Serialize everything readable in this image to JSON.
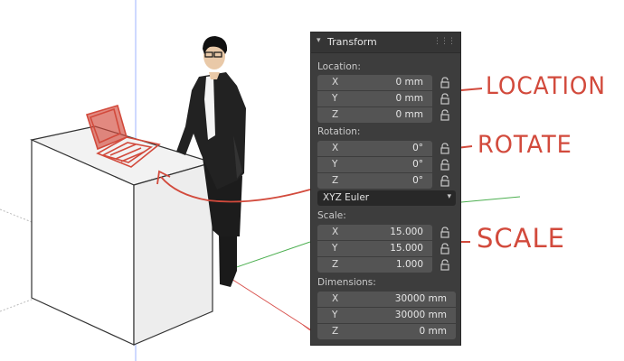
{
  "panel": {
    "title": "Transform",
    "location_label": "Location:",
    "location": [
      {
        "axis": "X",
        "value": "0 mm"
      },
      {
        "axis": "Y",
        "value": "0 mm"
      },
      {
        "axis": "Z",
        "value": "0 mm"
      }
    ],
    "rotation_label": "Rotation:",
    "rotation": [
      {
        "axis": "X",
        "value": "0°"
      },
      {
        "axis": "Y",
        "value": "0°"
      },
      {
        "axis": "Z",
        "value": "0°"
      }
    ],
    "rotation_mode": "XYZ Euler",
    "scale_label": "Scale:",
    "scale": [
      {
        "axis": "X",
        "value": "15.000"
      },
      {
        "axis": "Y",
        "value": "15.000"
      },
      {
        "axis": "Z",
        "value": "1.000"
      }
    ],
    "dimensions_label": "Dimensions:",
    "dimensions": [
      {
        "axis": "X",
        "value": "30000 mm"
      },
      {
        "axis": "Y",
        "value": "30000 mm"
      },
      {
        "axis": "Z",
        "value": "0 mm"
      }
    ]
  },
  "annotations": {
    "location": "LOCATION",
    "rotate": "ROTATE",
    "scale": "SCALE"
  },
  "colors": {
    "annotation": "#d24a3c",
    "panel_bg": "#3d3d3d",
    "field_bg": "#545454",
    "axis_green": "#4caf50",
    "axis_red": "#d9534f"
  }
}
